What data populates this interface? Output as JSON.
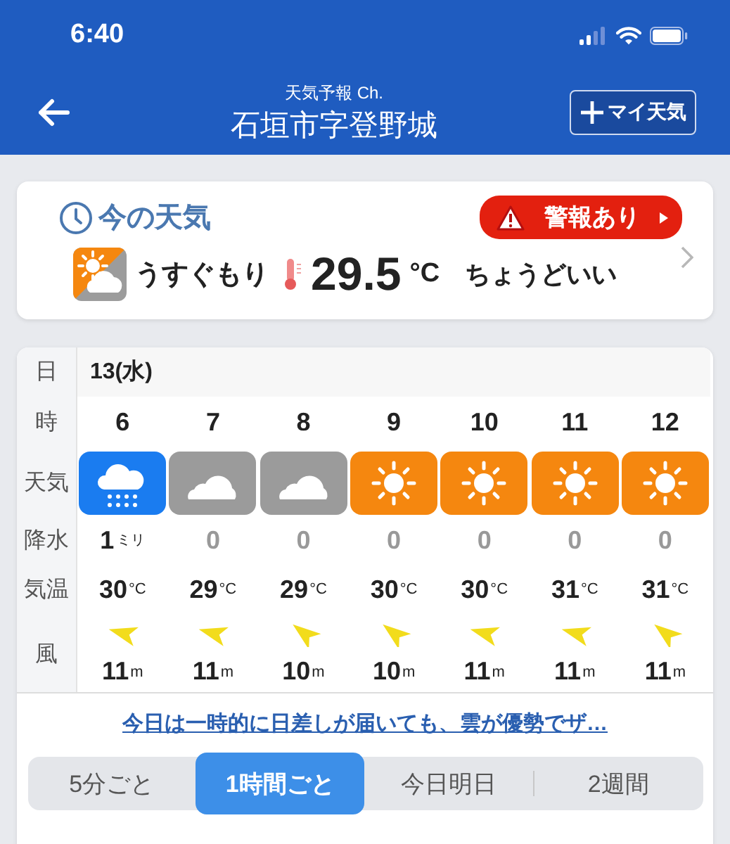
{
  "status_bar": {
    "time": "6:40"
  },
  "nav": {
    "subtitle": "天気予報 Ch.",
    "title": "石垣市字登野城",
    "add_button": "マイ天気"
  },
  "current": {
    "heading": "今の天気",
    "alert": "警報あり",
    "condition": "うすぐもり",
    "temperature": "29.5",
    "unit": "°C",
    "feeling": "ちょうどいい"
  },
  "forecast": {
    "labels": {
      "day": "日",
      "hour": "時",
      "weather": "天気",
      "precip": "降水",
      "temp": "気温",
      "wind": "風"
    },
    "day": "13(水)",
    "hours": [
      {
        "hour": "6",
        "kind": "rain",
        "precip": "1",
        "precip_unit": "ミリ",
        "temp": "30",
        "temp_unit": "°C",
        "wind_arrow": {
          "kind": "ese"
        },
        "wind": "11",
        "wind_unit": "m"
      },
      {
        "hour": "7",
        "kind": "cloudy",
        "precip": "0",
        "temp": "29",
        "temp_unit": "°C",
        "wind_arrow": {
          "kind": "ese"
        },
        "wind": "11",
        "wind_unit": "m"
      },
      {
        "hour": "8",
        "kind": "cloudy",
        "precip": "0",
        "temp": "29",
        "temp_unit": "°C",
        "wind_arrow": {
          "kind": "se"
        },
        "wind": "10",
        "wind_unit": "m"
      },
      {
        "hour": "9",
        "kind": "sunny",
        "precip": "0",
        "temp": "30",
        "temp_unit": "°C",
        "wind_arrow": {
          "kind": "se"
        },
        "wind": "10",
        "wind_unit": "m"
      },
      {
        "hour": "10",
        "kind": "sunny",
        "precip": "0",
        "temp": "30",
        "temp_unit": "°C",
        "wind_arrow": {
          "kind": "ese"
        },
        "wind": "11",
        "wind_unit": "m"
      },
      {
        "hour": "11",
        "kind": "sunny",
        "precip": "0",
        "temp": "31",
        "temp_unit": "°C",
        "wind_arrow": {
          "kind": "ese"
        },
        "wind": "11",
        "wind_unit": "m"
      },
      {
        "hour": "12",
        "kind": "sunny",
        "precip": "0",
        "temp": "31",
        "temp_unit": "°C",
        "wind_arrow": {
          "kind": "se"
        },
        "wind": "11",
        "wind_unit": "m"
      }
    ],
    "summary_link": "今日は一時的に日差しが届いても、雲が優勢でザ…"
  },
  "tabs": [
    {
      "label": "5分ごと",
      "selected": false
    },
    {
      "label": "1時間ごと",
      "selected": true
    },
    {
      "label": "今日明日",
      "selected": false
    },
    {
      "label": "2週間",
      "selected": false
    }
  ]
}
